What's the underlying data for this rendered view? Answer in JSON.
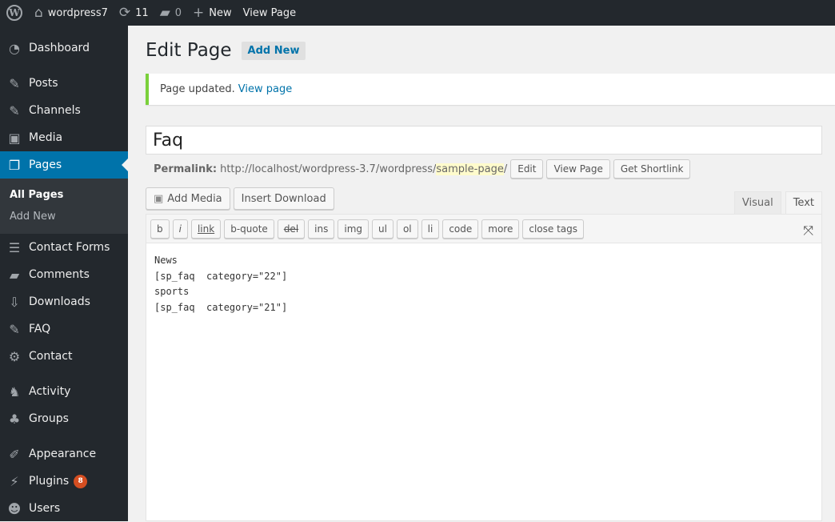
{
  "adminbar": {
    "site_name": "wordpress7",
    "updates_count": "11",
    "comments_count": "0",
    "new_label": "New",
    "view_page_label": "View Page"
  },
  "sidebar": {
    "items": [
      {
        "label": "Dashboard",
        "icon": "dashboard-icon"
      },
      {
        "label": "Posts",
        "icon": "pin-icon"
      },
      {
        "label": "Channels",
        "icon": "pin-icon"
      },
      {
        "label": "Media",
        "icon": "media-icon"
      },
      {
        "label": "Pages",
        "icon": "pages-icon"
      },
      {
        "label": "Contact Forms",
        "icon": "form-icon"
      },
      {
        "label": "Comments",
        "icon": "comment-icon"
      },
      {
        "label": "Downloads",
        "icon": "download-icon"
      },
      {
        "label": "FAQ",
        "icon": "pin-icon"
      },
      {
        "label": "Contact",
        "icon": "gear-icon"
      },
      {
        "label": "Activity",
        "icon": "activity-icon"
      },
      {
        "label": "Groups",
        "icon": "groups-icon"
      },
      {
        "label": "Appearance",
        "icon": "brush-icon"
      },
      {
        "label": "Plugins",
        "icon": "plug-icon",
        "badge": "8"
      },
      {
        "label": "Users",
        "icon": "user-icon"
      }
    ],
    "submenu": [
      "All Pages",
      "Add New"
    ]
  },
  "main": {
    "heading": "Edit Page",
    "add_new_label": "Add New",
    "notice_text": "Page updated.",
    "notice_link": "View page",
    "title_value": "Faq",
    "permalink_label": "Permalink:",
    "permalink_base": "http://localhost/wordpress-3.7/wordpress/",
    "permalink_slug": "sample-page",
    "permalink_trail": "/",
    "edit_label": "Edit",
    "view_page_label": "View Page",
    "shortlink_label": "Get Shortlink",
    "add_media_label": "Add Media",
    "insert_download_label": "Insert Download",
    "tab_visual": "Visual",
    "tab_text": "Text",
    "quicktags": [
      "b",
      "i",
      "link",
      "b-quote",
      "del",
      "ins",
      "img",
      "ul",
      "ol",
      "li",
      "code",
      "more",
      "close tags"
    ],
    "content": "News\n[sp_faq  category=\"22\"]\nsports\n[sp_faq  category=\"21\"]"
  }
}
